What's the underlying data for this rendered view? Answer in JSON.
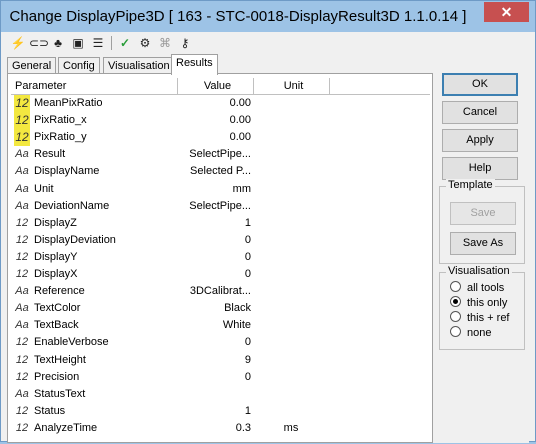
{
  "window": {
    "title": "Change DisplayPipe3D [ 163 - STC-0018-DisplayResult3D 1.1.0.14 ]",
    "close_label": "✕"
  },
  "toolbar": {
    "icons": [
      "lightning-icon",
      "link-icon",
      "puzzle-icon",
      "console-icon",
      "list-icon",
      "checkmark-icon",
      "tools-icon",
      "network-icon",
      "key-icon"
    ]
  },
  "tabs": [
    {
      "label": "General"
    },
    {
      "label": "Config"
    },
    {
      "label": "Visualisation"
    },
    {
      "label": "Results"
    }
  ],
  "grid": {
    "headers": {
      "parameter": "Parameter",
      "value": "Value",
      "unit": "Unit"
    },
    "rows": [
      {
        "icon": "12",
        "highlight": true,
        "name": "MeanPixRatio",
        "value": "0.00",
        "unit": ""
      },
      {
        "icon": "12",
        "highlight": true,
        "name": "PixRatio_x",
        "value": "0.00",
        "unit": ""
      },
      {
        "icon": "12",
        "highlight": true,
        "name": "PixRatio_y",
        "value": "0.00",
        "unit": ""
      },
      {
        "icon": "Aa",
        "highlight": false,
        "name": "Result",
        "value": "SelectPipe...",
        "unit": ""
      },
      {
        "icon": "Aa",
        "highlight": false,
        "name": "DisplayName",
        "value": "Selected P...",
        "unit": ""
      },
      {
        "icon": "Aa",
        "highlight": false,
        "name": "Unit",
        "value": "mm",
        "unit": ""
      },
      {
        "icon": "Aa",
        "highlight": false,
        "name": "DeviationName",
        "value": "SelectPipe...",
        "unit": ""
      },
      {
        "icon": "12",
        "highlight": false,
        "name": "DisplayZ",
        "value": "1",
        "unit": ""
      },
      {
        "icon": "12",
        "highlight": false,
        "name": "DisplayDeviation",
        "value": "0",
        "unit": ""
      },
      {
        "icon": "12",
        "highlight": false,
        "name": "DisplayY",
        "value": "0",
        "unit": ""
      },
      {
        "icon": "12",
        "highlight": false,
        "name": "DisplayX",
        "value": "0",
        "unit": ""
      },
      {
        "icon": "Aa",
        "highlight": false,
        "name": "Reference",
        "value": "3DCalibrat...",
        "unit": ""
      },
      {
        "icon": "Aa",
        "highlight": false,
        "name": "TextColor",
        "value": "Black",
        "unit": ""
      },
      {
        "icon": "Aa",
        "highlight": false,
        "name": "TextBack",
        "value": "White",
        "unit": ""
      },
      {
        "icon": "12",
        "highlight": false,
        "name": "EnableVerbose",
        "value": "0",
        "unit": ""
      },
      {
        "icon": "12",
        "highlight": false,
        "name": "TextHeight",
        "value": "9",
        "unit": ""
      },
      {
        "icon": "12",
        "highlight": false,
        "name": "Precision",
        "value": "0",
        "unit": ""
      },
      {
        "icon": "Aa",
        "highlight": false,
        "name": "StatusText",
        "value": "",
        "unit": ""
      },
      {
        "icon": "12",
        "highlight": false,
        "name": "Status",
        "value": "1",
        "unit": ""
      },
      {
        "icon": "12",
        "highlight": false,
        "name": "AnalyzeTime",
        "value": "0.3",
        "unit": "ms"
      }
    ]
  },
  "buttons": {
    "ok": "OK",
    "cancel": "Cancel",
    "apply": "Apply",
    "help": "Help",
    "save": "Save",
    "save_as": "Save As"
  },
  "template_group": {
    "title": "Template"
  },
  "visualisation_group": {
    "title": "Visualisation",
    "options": [
      {
        "label": "all tools",
        "selected": false
      },
      {
        "label": "this only",
        "selected": true
      },
      {
        "label": "this + ref",
        "selected": false
      },
      {
        "label": "none",
        "selected": false
      }
    ]
  }
}
